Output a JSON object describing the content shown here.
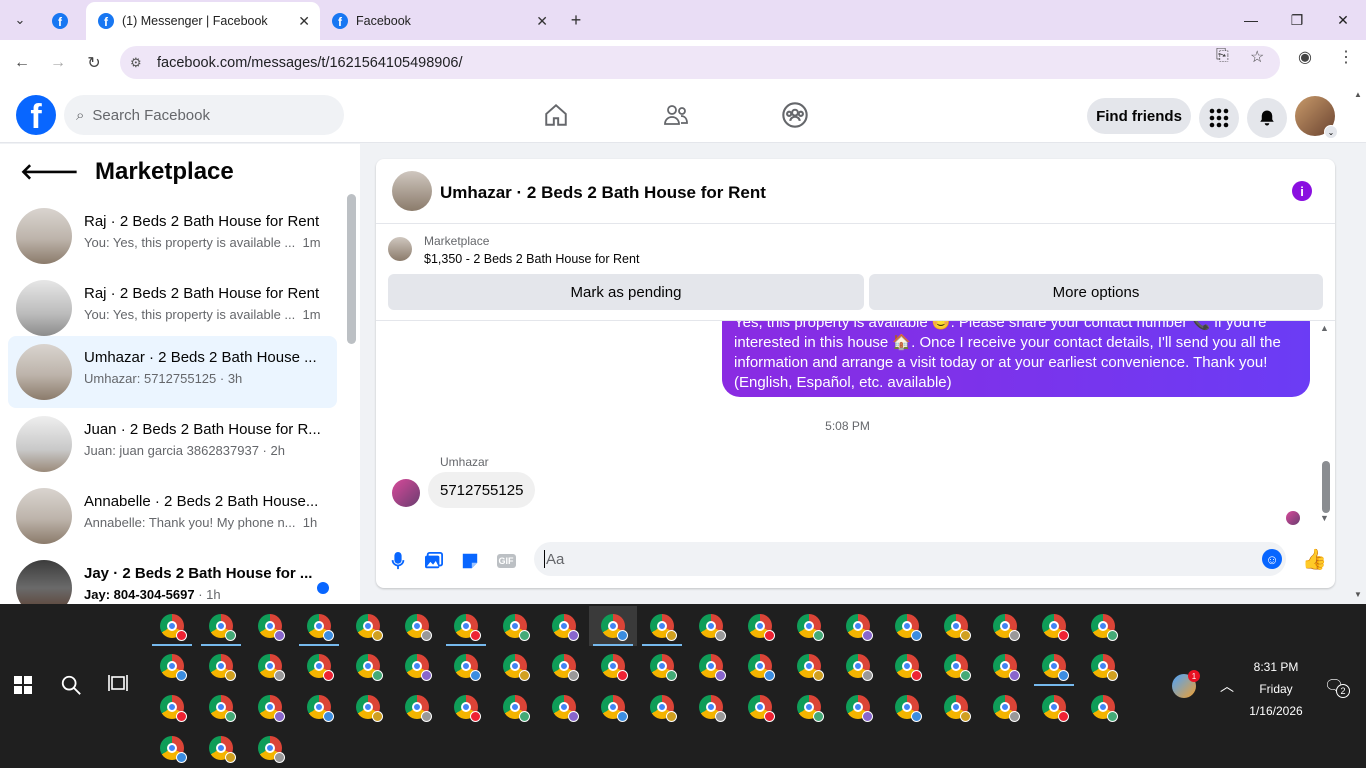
{
  "browser": {
    "tabs": [
      {
        "label": "(1) Messenger | Facebook",
        "active": true
      },
      {
        "label": "Facebook",
        "active": false
      }
    ],
    "url": "facebook.com/messages/t/1621564105498906/"
  },
  "header": {
    "search_placeholder": "Search Facebook",
    "find_friends": "Find friends"
  },
  "sidebar": {
    "title": "Marketplace",
    "conversations": [
      {
        "name": "Raj · 2 Beds 2 Bath House for Rent",
        "preview": "You: Yes, this property is available ...",
        "time": "1m"
      },
      {
        "name": "Raj · 2 Beds 2 Bath House for Rent",
        "preview": "You: Yes, this property is available ...",
        "time": "1m"
      },
      {
        "name": "Umhazar · 2 Beds 2 Bath House ...",
        "preview": "Umhazar: 5712755125 · 3h"
      },
      {
        "name": "Juan · 2 Beds 2 Bath House for R...",
        "preview": "Juan: juan garcia 3862837937 · 2h"
      },
      {
        "name": "Annabelle · 2 Beds 2 Bath House...",
        "preview": "Annabelle: Thank you! My phone n...",
        "time": "1h"
      },
      {
        "name": "Jay · 2 Beds 2 Bath House for ...",
        "preview": "Jay: 804-304-5697",
        "time": "· 1h"
      }
    ]
  },
  "chat": {
    "title": "Umhazar · 2 Beds 2 Bath House for Rent",
    "marketplace_label": "Marketplace",
    "listing": "$1,350 - 2 Beds 2 Bath House for Rent",
    "mark_pending": "Mark as pending",
    "more_options": "More options",
    "outgoing_message": "Yes, this property is available 😊. Please share your contact number 📞 if you're interested in this house 🏠. Once I receive your contact details, I'll send you all the information and arrange a visit today or at your earliest convenience. Thank you! (English, Español, etc. available)",
    "timestamp": "5:08 PM",
    "sender": "Umhazar",
    "incoming_message": "5712755125",
    "composer_placeholder": "Aa",
    "gif_label": "GIF"
  },
  "taskbar": {
    "time": "8:31 PM",
    "day": "Friday",
    "date": "1/16/2026",
    "weather_badge": "1",
    "notification_count": "2"
  },
  "colors": {
    "fb_blue": "#0866ff",
    "messenger_purple": "#7b2ff7",
    "selected_row": "#ebf5ff"
  }
}
